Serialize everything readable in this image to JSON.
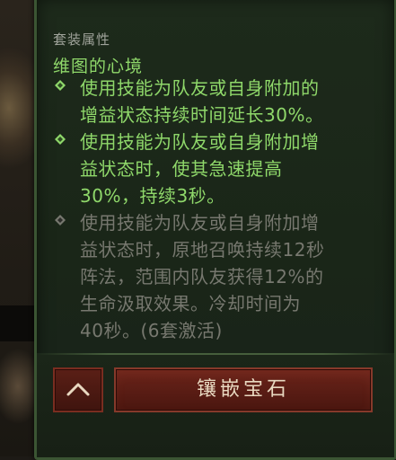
{
  "set": {
    "header": "套装属性",
    "name": "维图的心境"
  },
  "bonuses": [
    {
      "text": "使用技能为队友或自身附加的\n增益状态持续时间延长30%。",
      "state": "active",
      "icon": "diamond-bullet-icon"
    },
    {
      "text": "使用技能为队友或自身附加增\n益状态时，使其急速提高\n30%，持续3秒。",
      "state": "active",
      "icon": "diamond-bullet-icon"
    },
    {
      "text": "使用技能为队友或自身附加增\n益状态时，原地召唤持续12秒\n阵法，范围内队友获得12%的\n生命汲取效果。冷却时间为\n40秒。(6套激活)",
      "state": "inactive",
      "icon": "diamond-bullet-icon"
    }
  ],
  "buttons": {
    "collapse_icon": "chevron-up-icon",
    "socket_label": "镶嵌宝石"
  },
  "colors": {
    "active_text": "#8fd86a",
    "inactive_text": "#77786f",
    "header_text": "#9fa39a",
    "panel_border": "#3b5533",
    "button_red": "#6b241a"
  }
}
